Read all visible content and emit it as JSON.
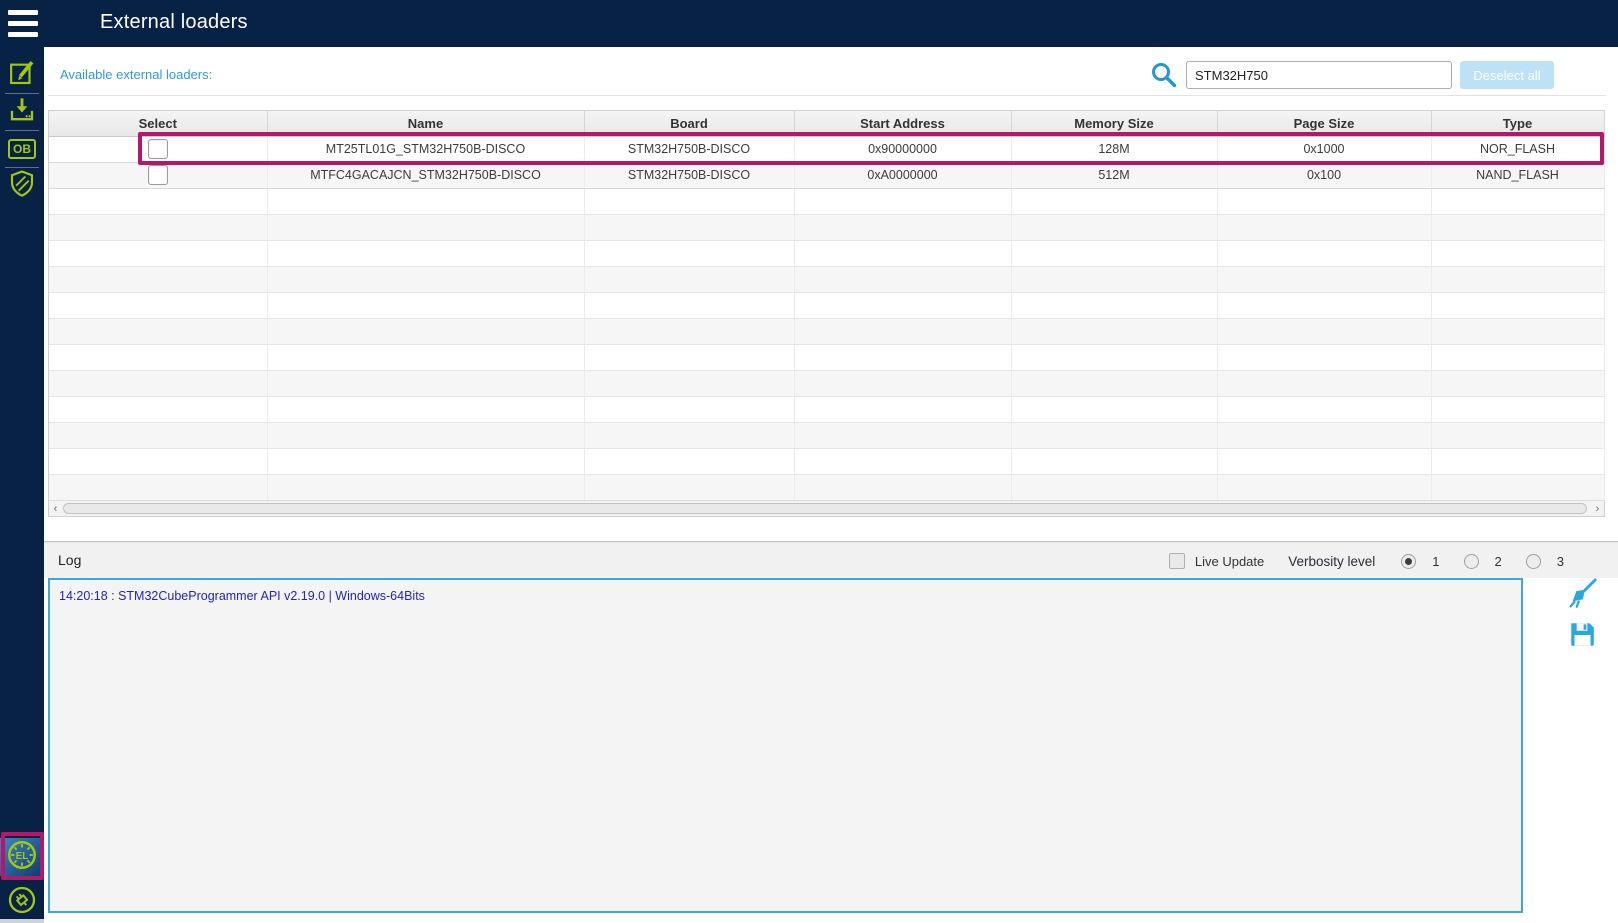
{
  "topbar": {
    "title": "External loaders"
  },
  "sidebar": {
    "items": [
      {
        "name": "memory-file-edition",
        "icon": "pencil-square-icon"
      },
      {
        "name": "erasing-programming",
        "icon": "download-icon"
      },
      {
        "name": "option-bytes",
        "icon": "ob-icon",
        "label": "OB"
      },
      {
        "name": "secure-programming",
        "icon": "shield-icon"
      }
    ],
    "bottom_items": [
      {
        "name": "external-loaders",
        "icon": "el-chip-icon",
        "label": "EL",
        "selected": true
      },
      {
        "name": "probe-connector",
        "icon": "connector-icon"
      }
    ]
  },
  "loaders": {
    "label": "Available external loaders:",
    "search": {
      "value": "STM32H750"
    },
    "deselect_button": "Deselect all",
    "table": {
      "columns": [
        "Select",
        "Name",
        "Board",
        "Start Address",
        "Memory Size",
        "Page Size",
        "Type"
      ],
      "rows": [
        {
          "selected": false,
          "name": "MT25TL01G_STM32H750B-DISCO",
          "board": "STM32H750B-DISCO",
          "start_address": "0x90000000",
          "memory_size": "128M",
          "page_size": "0x1000",
          "type": "NOR_FLASH",
          "highlighted": true
        },
        {
          "selected": false,
          "name": "MTFC4GACAJCN_STM32H750B-DISCO",
          "board": "STM32H750B-DISCO",
          "start_address": "0xA0000000",
          "memory_size": "512M",
          "page_size": "0x100",
          "type": "NAND_FLASH",
          "highlighted": false
        }
      ],
      "empty_rows": 12
    },
    "hscroll": {
      "left_arrow": "‹",
      "right_arrow": "›"
    }
  },
  "log": {
    "title": "Log",
    "live_update_label": "Live Update",
    "live_update_checked": false,
    "verbosity_label": "Verbosity level",
    "verbosity_options": [
      "1",
      "2",
      "3"
    ],
    "verbosity_selected": "1",
    "entries": [
      "14:20:18 : STM32CubeProgrammer API v2.19.0 | Windows-64Bits"
    ]
  },
  "colors": {
    "navy": "#072244",
    "accent_blue": "#39a9dc",
    "icon_green": "#a4c710",
    "annotation_magenta": "#b5186b",
    "log_text_blue": "#2323c4",
    "deselect_bg": "#bee2f5"
  }
}
